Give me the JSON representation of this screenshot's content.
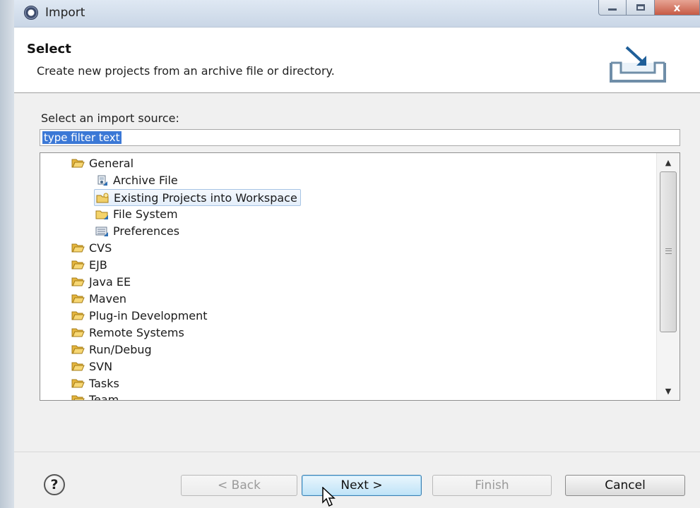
{
  "window": {
    "title": "Import",
    "close_glyph": "x"
  },
  "header": {
    "title": "Select",
    "description": "Create new projects from an archive file or directory."
  },
  "source_label": "Select an import source:",
  "filter": {
    "value": "type filter text"
  },
  "tree": {
    "items": [
      {
        "label": "General",
        "icon": "folder-open-icon",
        "level": 0
      },
      {
        "label": "Archive File",
        "icon": "archive-file-icon",
        "level": 1
      },
      {
        "label": "Existing Projects into Workspace",
        "icon": "existing-project-icon",
        "level": 1,
        "selected": true
      },
      {
        "label": "File System",
        "icon": "folder-icon",
        "level": 1
      },
      {
        "label": "Preferences",
        "icon": "preferences-icon",
        "level": 1
      },
      {
        "label": "CVS",
        "icon": "folder-open-icon",
        "level": 0
      },
      {
        "label": "EJB",
        "icon": "folder-open-icon",
        "level": 0
      },
      {
        "label": "Java EE",
        "icon": "folder-open-icon",
        "level": 0
      },
      {
        "label": "Maven",
        "icon": "folder-open-icon",
        "level": 0
      },
      {
        "label": "Plug-in Development",
        "icon": "folder-open-icon",
        "level": 0
      },
      {
        "label": "Remote Systems",
        "icon": "folder-open-icon",
        "level": 0
      },
      {
        "label": "Run/Debug",
        "icon": "folder-open-icon",
        "level": 0
      },
      {
        "label": "SVN",
        "icon": "folder-open-icon",
        "level": 0
      },
      {
        "label": "Tasks",
        "icon": "folder-open-icon",
        "level": 0
      },
      {
        "label": "Team",
        "icon": "folder-open-icon",
        "level": 0
      }
    ]
  },
  "buttons": {
    "help": "?",
    "back": "< Back",
    "next": "Next >",
    "finish": "Finish",
    "cancel": "Cancel"
  },
  "colors": {
    "accent": "#3b78d6",
    "folder": "#f2c94c"
  }
}
